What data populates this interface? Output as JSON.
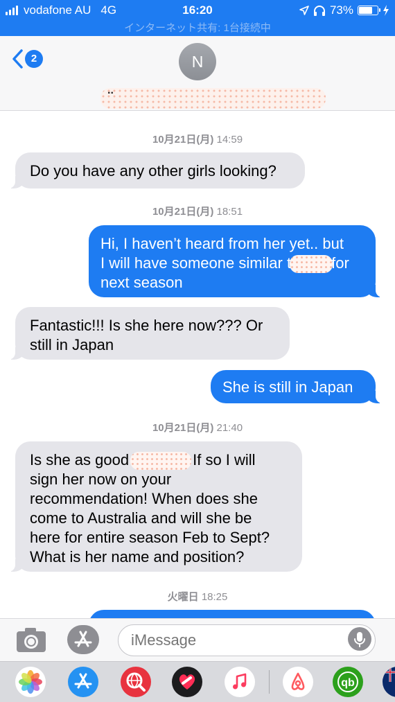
{
  "status_bar": {
    "carrier": "vodafone AU",
    "network": "4G",
    "time": "16:20",
    "battery": "73%",
    "battery_level": 0.73,
    "icons": [
      "signal-bars-icon",
      "location-arrow-icon",
      "headphones-icon",
      "battery-icon",
      "charging-bolt-icon"
    ]
  },
  "hotspot_banner": "インターネット共有: 1台接続中",
  "header": {
    "back_badge": "2",
    "avatar_initial": "N",
    "contact_name_prefix": ".."
  },
  "messages": [
    {
      "type": "timestamp",
      "date": "10月21日(月)",
      "time": "14:59"
    },
    {
      "type": "incoming",
      "lines": [
        "Do you have any other girls looking?"
      ]
    },
    {
      "type": "timestamp",
      "date": "10月21日(月)",
      "time": "18:51"
    },
    {
      "type": "outgoing",
      "line1": "Hi, I haven’t heard from her yet.. but",
      "line2_before": "I will have someone similar t",
      "line2_after": "for",
      "line3": "next season"
    },
    {
      "type": "incoming",
      "lines": [
        "Fantastic!!! Is she here now??? Or",
        "still in Japan"
      ]
    },
    {
      "type": "outgoing",
      "lines": [
        "She is still in Japan"
      ]
    },
    {
      "type": "timestamp",
      "date": "10月21日(月)",
      "time": "21:40"
    },
    {
      "type": "incoming",
      "line1_before": "Is she as good",
      "line1_after": "If so I will",
      "lines_rest": [
        "sign her now on your",
        "recommendation! When does she",
        "come to Australia and will she be",
        "here for entire season Feb to Sept?",
        "What is her name and position?"
      ]
    },
    {
      "type": "timestamp",
      "date": "火曜日",
      "time": "18:25"
    }
  ],
  "input": {
    "placeholder": "iMessage"
  },
  "app_drawer": {
    "apps": [
      "photos-icon",
      "app-store-icon",
      "web-search-icon",
      "digital-touch-icon",
      "music-icon",
      "airbnb-icon",
      "quickbooks-icon",
      "flag-icon"
    ]
  },
  "colors": {
    "imessage_blue": "#1e7cf2",
    "incoming_bubble": "#e5e5ea",
    "timestamp_gray": "#8e8e93",
    "redaction": "#f6b9a6"
  }
}
